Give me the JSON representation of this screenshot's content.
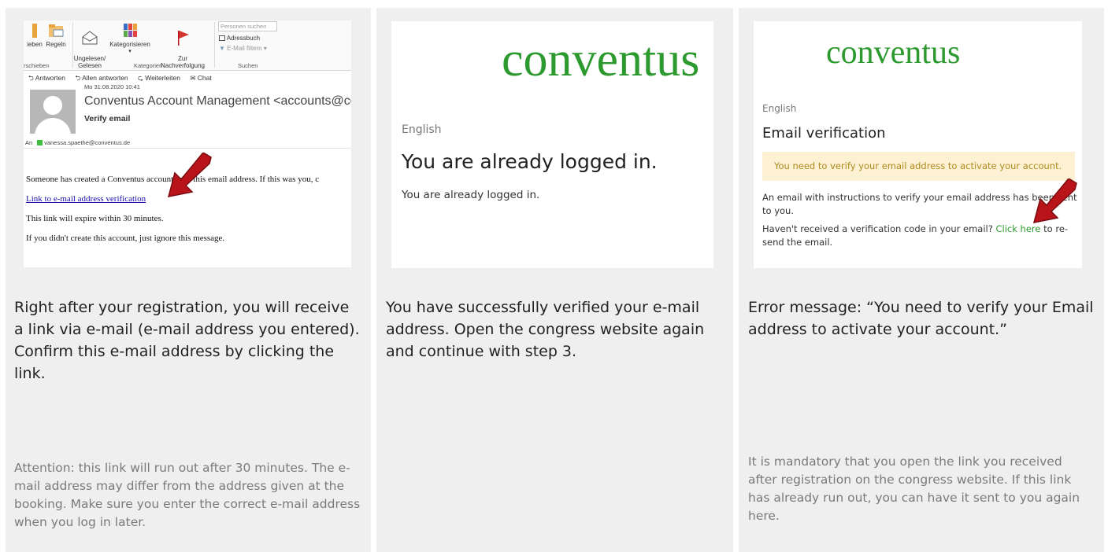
{
  "panel1": {
    "ribbon": {
      "items": [
        "ieben",
        "Regeln",
        "Ungelesen/\nGelesen",
        "Kategorisieren",
        "Zur\nNachverfolgung"
      ],
      "groups": [
        "rschieben",
        "Kategorien",
        "Suchen"
      ],
      "search_placeholder": "Personen suchen",
      "addressbook": "Adressbuch",
      "filter": "E-Mail filtern"
    },
    "reply_actions": [
      "Antworten",
      "Allen antworten",
      "Weiterleiten",
      "Chat"
    ],
    "date": "Mo 31.08.2020 10:41",
    "from": "Conventus Account Management <accounts@co",
    "subject": "Verify email",
    "to_label": "An",
    "to_address": "vanessa.spaethe@conventus.de",
    "body": {
      "line1": "Someone has created a Conventus account with this email address. If this was you, c",
      "link": "Link to e-mail address verification",
      "line2": "This link will expire within 30 minutes.",
      "line3": "If you didn't create this account, just ignore this message."
    },
    "caption": "Right after your registration, you will receive a link via e-mail (e-mail address you entered). Confirm this e-mail address by clicking the link.",
    "note": "Attention: this link will run out after 30 minutes. The e-mail address may differ from the address given at the booking. Make sure you enter the correct e-mail address when you log in later."
  },
  "panel2": {
    "logo": "conventus",
    "language": "English",
    "heading": "You are already logged in.",
    "text": "You are already logged in.",
    "caption": "You have successfully verified your e-mail address. Open the congress website again and continue with step 3."
  },
  "panel3": {
    "logo": "conventus",
    "language": "English",
    "heading": "Email verification",
    "alert": "You need to verify your email address to activate your account.",
    "info": "An email with instructions to verify your email address has been sent to you.",
    "resend_prefix": "Haven't received a verification code in your email? ",
    "resend_link": "Click here",
    "resend_suffix": " to re-send the email.",
    "caption": "Error message: “You need to verify your Email address to activate your account.”",
    "note": "It is mandatory that you open the link you received after registration on the congress website. If this link has already run out, you can have it sent to you again here."
  },
  "colors": {
    "panel_bg": "#efefef",
    "brand_green": "#2d9a2f",
    "arrow_red": "#b8141a",
    "alert_bg": "#fcf1d2",
    "alert_text": "#b08a1e",
    "note_text": "#7a7a7a"
  }
}
